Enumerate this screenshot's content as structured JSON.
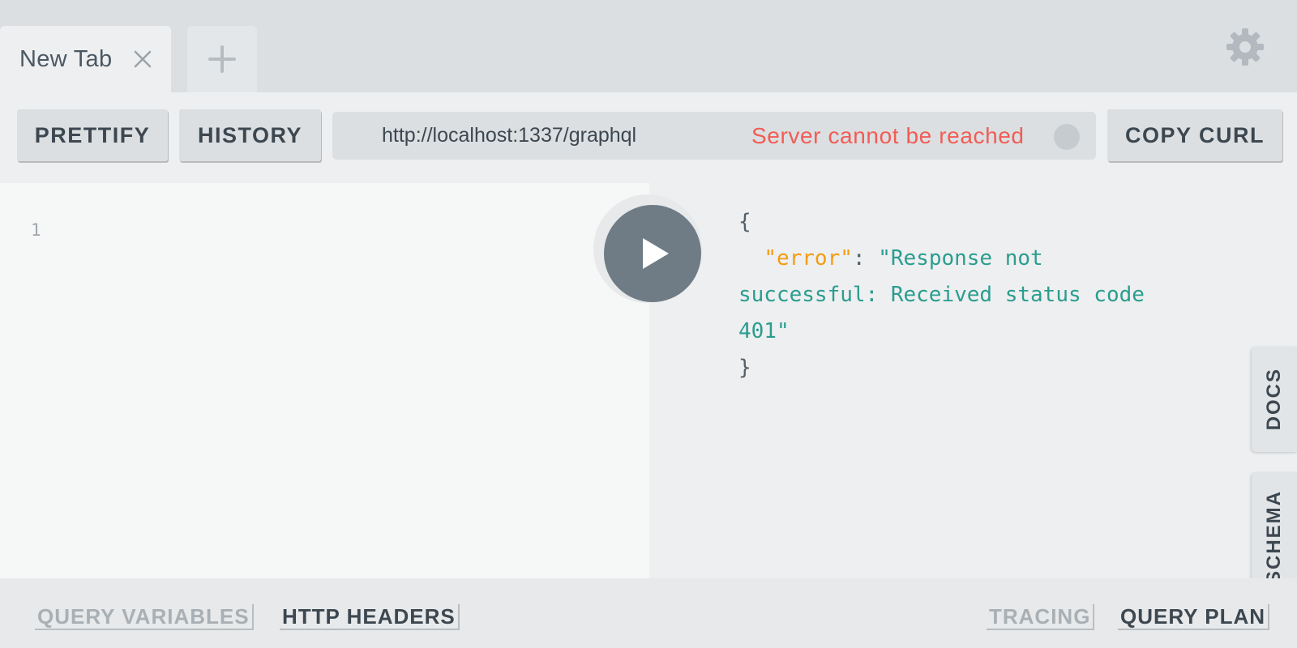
{
  "tabs": [
    {
      "title": "New Tab",
      "close": "close-icon"
    }
  ],
  "icons": {
    "add_tab": "plus-icon",
    "settings": "gear-icon",
    "run": "play-icon"
  },
  "toolbar": {
    "prettify_label": "PRETTIFY",
    "history_label": "HISTORY",
    "url": "http://localhost:1337/graphql",
    "status": "Server cannot be reached",
    "copy_curl_label": "COPY CURL"
  },
  "editor": {
    "line_numbers": [
      "1"
    ]
  },
  "result": {
    "open_brace": "{",
    "key": "\"error\"",
    "colon": ": ",
    "value": "\"Response not successful: Received status code 401\"",
    "close_brace": "}"
  },
  "side_tabs": {
    "docs": "DOCS",
    "schema": "SCHEMA"
  },
  "bottom": {
    "query_variables": "QUERY VARIABLES",
    "http_headers": "HTTP HEADERS",
    "tracing": "TRACING",
    "query_plan": "QUERY PLAN"
  },
  "colors": {
    "error_status": "#f25c54",
    "json_key": "#f39c12",
    "json_string": "#2a9d8f",
    "run_button": "#6f7c86"
  }
}
